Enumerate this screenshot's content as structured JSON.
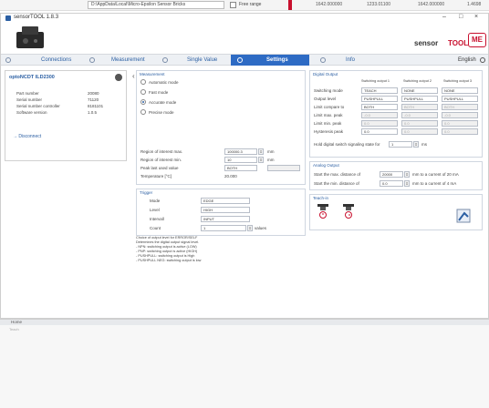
{
  "background": {
    "path": "D:\\AppData\\Local\\Micro-Epsilon Sensor Bricks",
    "checkbox_label": "Free range",
    "values": [
      "1642.000000",
      "1233.01100",
      "1642.000000",
      "1.4698"
    ]
  },
  "window": {
    "title": "sensorTOOL 1.8.3",
    "controls": [
      "–",
      "□",
      "×"
    ]
  },
  "brand": {
    "sensor": "sensor",
    "tool": "TOOL",
    "mark": "ME"
  },
  "nav": {
    "connections": "Connections",
    "measurement": "Measurement",
    "single_value": "Single Value",
    "settings": "Settings",
    "info": "Info",
    "language": "English"
  },
  "sensor_panel": {
    "title": "optoNCDT ILD2300",
    "rows": [
      {
        "label": "Part number",
        "value": "20080"
      },
      {
        "label": "Serial number",
        "value": "71120"
      },
      {
        "label": "Serial number controller",
        "value": "8181101"
      },
      {
        "label": "Software version",
        "value": "1.0.5"
      }
    ],
    "disconnect": "Disconnect"
  },
  "measure_box": {
    "title": "Measurement",
    "modes": [
      {
        "label": "Automatic mode",
        "selected": false
      },
      {
        "label": "Fast mode",
        "selected": false
      },
      {
        "label": "Accurate mode",
        "selected": true
      },
      {
        "label": "Precise mode",
        "selected": false
      }
    ],
    "fields": [
      {
        "label": "Region of interest max.",
        "value": "100000.3",
        "unit": "mm"
      },
      {
        "label": "Region of interest min.",
        "value": "10",
        "unit": "mm"
      },
      {
        "label": "Peak last used value",
        "value": "BOTH",
        "unit": ""
      },
      {
        "label": "Temperature [°C]",
        "value": "20.000",
        "unit": ""
      }
    ]
  },
  "trigger_box": {
    "title": "Trigger",
    "rows": [
      {
        "label": "Mode",
        "value": "EDGE"
      },
      {
        "label": "Level",
        "value": "HIGH"
      },
      {
        "label": "Intervall",
        "value": "INPUT"
      },
      {
        "label": "Count",
        "value": "1",
        "unit": "values"
      }
    ]
  },
  "digital_box": {
    "title": "Digital Output",
    "col_headers": [
      "Switching output 1",
      "Switching output 2",
      "Switching output 3"
    ],
    "rows": [
      {
        "label": "Switching mode",
        "values": [
          "TEACH",
          "NONE",
          "NONE"
        ],
        "disabled": [
          false,
          false,
          false
        ]
      },
      {
        "label": "Output level",
        "values": [
          "PUSHPULL",
          "PUSHPULL",
          "PUSHPULL"
        ],
        "disabled": [
          false,
          false,
          false
        ]
      },
      {
        "label": "Limit compare to",
        "values": [
          "BOTH",
          "BOTH",
          "BOTH"
        ],
        "disabled": [
          false,
          true,
          true
        ]
      },
      {
        "label": "Limit max. peak",
        "values": [
          "-0.0",
          "-0.0",
          "-0.0"
        ],
        "disabled": [
          true,
          true,
          true
        ]
      },
      {
        "label": "Limit min. peak",
        "values": [
          "0.0",
          "0.0",
          "0.0"
        ],
        "disabled": [
          true,
          true,
          true
        ]
      },
      {
        "label": "Hysteresis peak",
        "values": [
          "0.0",
          "0.0",
          "0.0"
        ],
        "disabled": [
          false,
          true,
          true
        ]
      }
    ],
    "hold_label": "Hold digital switch signaling state for",
    "hold_value": "1",
    "hold_unit": "ms"
  },
  "analog_box": {
    "title": "Analog Output",
    "rows": [
      {
        "label": "Start the max. distance of",
        "value": "20000",
        "suffix": "mm to a current of  20 mA"
      },
      {
        "label": "Start the min. distance of",
        "value": "0.0",
        "suffix": "mm to a current of  4 mA"
      }
    ]
  },
  "teach_box": {
    "title": "Teach-in"
  },
  "help": {
    "lines": [
      "Choice of output level for ERROR/SELF",
      "Determines the digital output signal level.",
      "- NPN: switching output is active (LOW)",
      "- PNP: switching output is active (HIGH)",
      "- PUSHPULL: switching output is High",
      "- PUSHPULL NEG: switching output is low"
    ]
  },
  "bottom": {
    "label": "Home",
    "left_text": "Teach"
  },
  "colors": {
    "accent": "#2e6bc4",
    "brand_red": "#c8102e"
  }
}
